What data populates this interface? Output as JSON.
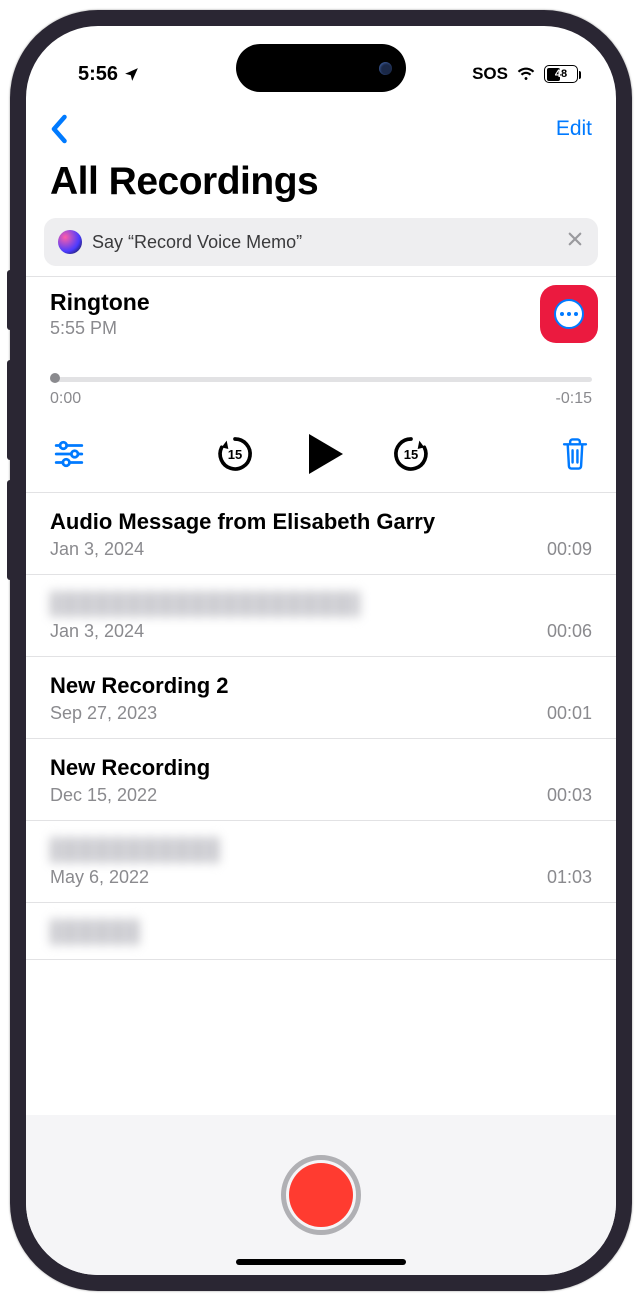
{
  "status": {
    "time": "5:56",
    "sos": "SOS",
    "battery": "48"
  },
  "nav": {
    "edit": "Edit"
  },
  "title": "All Recordings",
  "siri": {
    "prefix": "Say ",
    "quoted": "“Record Voice Memo”"
  },
  "selected": {
    "title": "Ringtone",
    "subtitle": "5:55 PM",
    "elapsed": "0:00",
    "remaining": "-0:15",
    "skipBack": "15",
    "skipFwd": "15"
  },
  "items": [
    {
      "title": "Audio Message from Elisabeth Garry",
      "date": "Jan 3, 2024",
      "duration": "00:09",
      "redacted": false
    },
    {
      "title": "",
      "date": "Jan 3, 2024",
      "duration": "00:06",
      "redacted": true,
      "redactWidth": 310
    },
    {
      "title": "New Recording 2",
      "date": "Sep 27, 2023",
      "duration": "00:01",
      "redacted": false
    },
    {
      "title": "New Recording",
      "date": "Dec 15, 2022",
      "duration": "00:03",
      "redacted": false
    },
    {
      "title": "",
      "date": "May 6, 2022",
      "duration": "01:03",
      "redacted": true,
      "redactWidth": 170
    },
    {
      "title": "",
      "date": "",
      "duration": "",
      "redacted": true,
      "redactWidth": 90
    }
  ]
}
